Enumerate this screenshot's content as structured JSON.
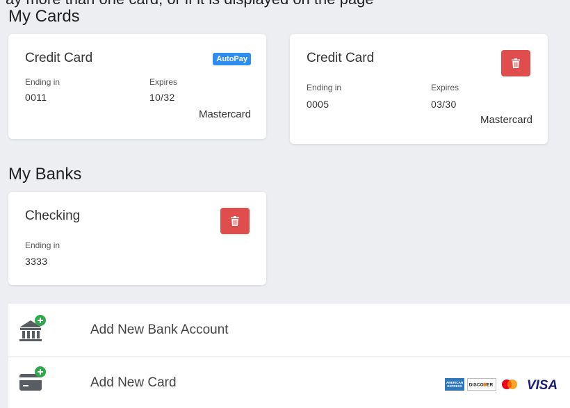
{
  "top_clip_text": "ay more than one card, or if it is displayed on the page",
  "cards_section": {
    "title": "My Cards",
    "cards": [
      {
        "title": "Credit Card",
        "badge": "AutoPay",
        "ending_label": "Ending in",
        "ending_value": "0011",
        "expires_label": "Expires",
        "expires_value": "10/32",
        "brand": "Mastercard"
      },
      {
        "title": "Credit Card",
        "ending_label": "Ending in",
        "ending_value": "0005",
        "expires_label": "Expires",
        "expires_value": "03/30",
        "brand": "Mastercard",
        "action_icon": "trash-icon"
      }
    ]
  },
  "banks_section": {
    "title": "My Banks",
    "banks": [
      {
        "title": "Checking",
        "ending_label": "Ending in",
        "ending_value": "3333",
        "action_icon": "trash-icon"
      }
    ]
  },
  "actions": {
    "add_bank": {
      "label": "Add New Bank Account",
      "icon": "bank-add-icon"
    },
    "add_card": {
      "label": "Add New Card",
      "icon": "card-add-icon"
    }
  },
  "accepted_cards": [
    "amex",
    "discover",
    "mastercard",
    "visa"
  ],
  "accepted_cards_text": {
    "amex": "AMERICAN EXPRESS",
    "discover": "DISCOVER",
    "visa": "VISA"
  },
  "colors": {
    "background": "#eceef1",
    "autopay_badge": "#2f8cf0",
    "delete_button": "#e04d4d",
    "icon_gray": "#585d63",
    "plus_green": "#2ea84a",
    "visa_blue": "#1a1f71"
  }
}
